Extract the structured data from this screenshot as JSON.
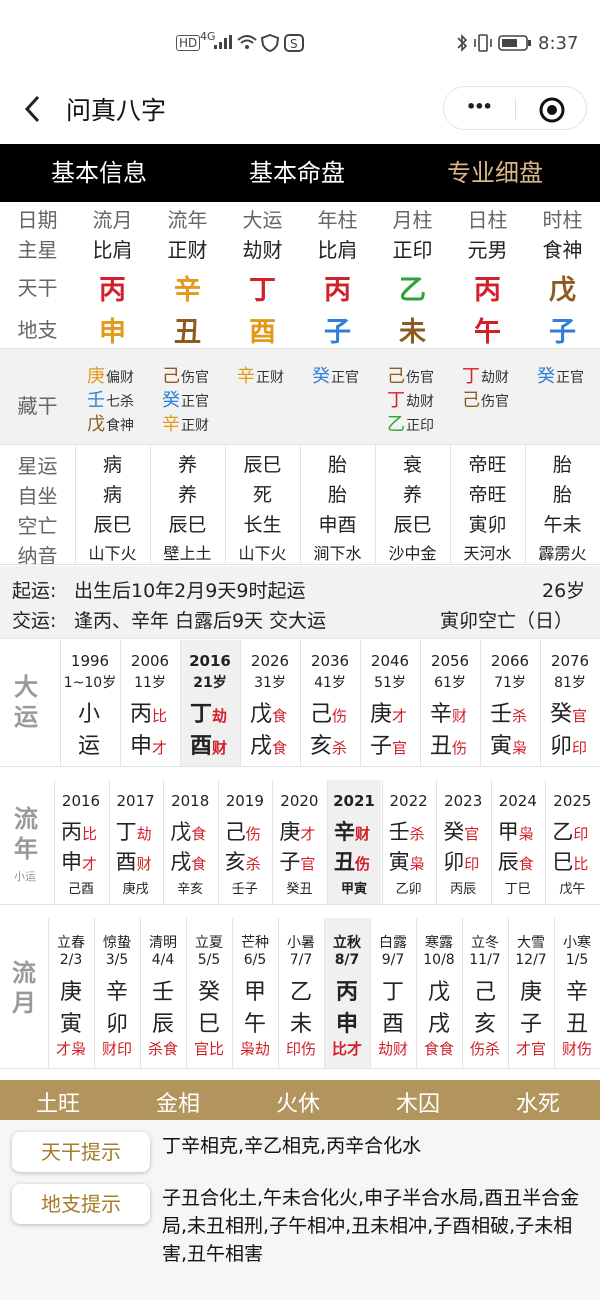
{
  "status": {
    "badge_hd": "HD",
    "net": "4G",
    "time": "8:37"
  },
  "app": {
    "title": "问真八字",
    "back": "〈",
    "more": "•••"
  },
  "tabs": [
    {
      "label": "基本信息"
    },
    {
      "label": "基本命盘"
    },
    {
      "label": "专业细盘"
    }
  ],
  "chart": {
    "row_labels": [
      "日期",
      "主星",
      "天干",
      "地支"
    ],
    "columns": [
      {
        "head": "流月",
        "star": "比肩",
        "stem": "丙",
        "branch": "申"
      },
      {
        "head": "流年",
        "star": "正财",
        "stem": "辛",
        "branch": "丑"
      },
      {
        "head": "大运",
        "star": "劫财",
        "stem": "丁",
        "branch": "酉"
      },
      {
        "head": "年柱",
        "star": "比肩",
        "stem": "丙",
        "branch": "子"
      },
      {
        "head": "月柱",
        "star": "正印",
        "stem": "乙",
        "branch": "未"
      },
      {
        "head": "日柱",
        "star": "元男",
        "stem": "丙",
        "branch": "午"
      },
      {
        "head": "时柱",
        "star": "食神",
        "stem": "戊",
        "branch": "子"
      }
    ],
    "hidden_label": "藏干",
    "hidden": [
      [
        [
          "庚",
          "偏财"
        ],
        [
          "壬",
          "七杀"
        ],
        [
          "戊",
          "食神"
        ]
      ],
      [
        [
          "己",
          "伤官"
        ],
        [
          "癸",
          "正官"
        ],
        [
          "辛",
          "正财"
        ]
      ],
      [
        [
          "辛",
          "正财"
        ]
      ],
      [
        [
          "癸",
          "正官"
        ]
      ],
      [
        [
          "己",
          "伤官"
        ],
        [
          "丁",
          "劫财"
        ],
        [
          "乙",
          "正印"
        ]
      ],
      [
        [
          "丁",
          "劫财"
        ],
        [
          "己",
          "伤官"
        ]
      ],
      [
        [
          "癸",
          "正官"
        ]
      ]
    ],
    "extra_labels": [
      "星运",
      "自坐",
      "空亡",
      "纳音"
    ],
    "extra": [
      [
        "病",
        "病",
        "辰巳",
        "山下火"
      ],
      [
        "养",
        "养",
        "辰巳",
        "壁上土"
      ],
      [
        "辰巳",
        "死",
        "长生",
        "山下火"
      ],
      [
        "胎",
        "胎",
        "申酉",
        "涧下水"
      ],
      [
        "衰",
        "养",
        "辰巳",
        "沙中金"
      ],
      [
        "帝旺",
        "帝旺",
        "寅卯",
        "天河水"
      ],
      [
        "胎",
        "胎",
        "午未",
        "霹雳火"
      ]
    ]
  },
  "info": {
    "qiyun_label": "起运:",
    "qiyun": "出生后10年2月9天9时起运",
    "age": "26岁",
    "jiaoyun_label": "交运:",
    "jiaoyun": "逢丙、辛年 白露后9天 交大运",
    "kongwang": "寅卯空亡（日）"
  },
  "dayun": {
    "label": "大运",
    "items": [
      {
        "year": "1996",
        "age": "1~10岁",
        "g1": "小",
        "g2": "运",
        "t1": "",
        "t2": ""
      },
      {
        "year": "2006",
        "age": "11岁",
        "g1": "丙",
        "g2": "申",
        "t1": "比",
        "t2": "才"
      },
      {
        "year": "2016",
        "age": "21岁",
        "g1": "丁",
        "g2": "酉",
        "t1": "劫",
        "t2": "财"
      },
      {
        "year": "2026",
        "age": "31岁",
        "g1": "戊",
        "g2": "戌",
        "t1": "食",
        "t2": "食"
      },
      {
        "year": "2036",
        "age": "41岁",
        "g1": "己",
        "g2": "亥",
        "t1": "伤",
        "t2": "杀"
      },
      {
        "year": "2046",
        "age": "51岁",
        "g1": "庚",
        "g2": "子",
        "t1": "才",
        "t2": "官"
      },
      {
        "year": "2056",
        "age": "61岁",
        "g1": "辛",
        "g2": "丑",
        "t1": "财",
        "t2": "伤"
      },
      {
        "year": "2066",
        "age": "71岁",
        "g1": "壬",
        "g2": "寅",
        "t1": "杀",
        "t2": "枭"
      },
      {
        "year": "2076",
        "age": "81岁",
        "g1": "癸",
        "g2": "卯",
        "t1": "官",
        "t2": "印"
      }
    ]
  },
  "liunian": {
    "label": "流年",
    "sub": "小运",
    "items": [
      {
        "year": "2016",
        "g1": "丙",
        "g2": "申",
        "t1": "比",
        "t2": "才",
        "xy": "己酉"
      },
      {
        "year": "2017",
        "g1": "丁",
        "g2": "酉",
        "t1": "劫",
        "t2": "财",
        "xy": "庚戌"
      },
      {
        "year": "2018",
        "g1": "戊",
        "g2": "戌",
        "t1": "食",
        "t2": "食",
        "xy": "辛亥"
      },
      {
        "year": "2019",
        "g1": "己",
        "g2": "亥",
        "t1": "伤",
        "t2": "杀",
        "xy": "壬子"
      },
      {
        "year": "2020",
        "g1": "庚",
        "g2": "子",
        "t1": "才",
        "t2": "官",
        "xy": "癸丑"
      },
      {
        "year": "2021",
        "g1": "辛",
        "g2": "丑",
        "t1": "财",
        "t2": "伤",
        "xy": "甲寅"
      },
      {
        "year": "2022",
        "g1": "壬",
        "g2": "寅",
        "t1": "杀",
        "t2": "枭",
        "xy": "乙卯"
      },
      {
        "year": "2023",
        "g1": "癸",
        "g2": "卯",
        "t1": "官",
        "t2": "印",
        "xy": "丙辰"
      },
      {
        "year": "2024",
        "g1": "甲",
        "g2": "辰",
        "t1": "枭",
        "t2": "食",
        "xy": "丁巳"
      },
      {
        "year": "2025",
        "g1": "乙",
        "g2": "巳",
        "t1": "印",
        "t2": "比",
        "xy": "戊午"
      }
    ]
  },
  "liuyue": {
    "label": "流月",
    "items": [
      {
        "term": "立春",
        "date": "2/3",
        "g1": "庚",
        "g2": "寅",
        "tag": "才枭"
      },
      {
        "term": "惊蛰",
        "date": "3/5",
        "g1": "辛",
        "g2": "卯",
        "tag": "财印"
      },
      {
        "term": "清明",
        "date": "4/4",
        "g1": "壬",
        "g2": "辰",
        "tag": "杀食"
      },
      {
        "term": "立夏",
        "date": "5/5",
        "g1": "癸",
        "g2": "巳",
        "tag": "官比"
      },
      {
        "term": "芒种",
        "date": "6/5",
        "g1": "甲",
        "g2": "午",
        "tag": "枭劫"
      },
      {
        "term": "小暑",
        "date": "7/7",
        "g1": "乙",
        "g2": "未",
        "tag": "印伤"
      },
      {
        "term": "立秋",
        "date": "8/7",
        "g1": "丙",
        "g2": "申",
        "tag": "比才"
      },
      {
        "term": "白露",
        "date": "9/7",
        "g1": "丁",
        "g2": "酉",
        "tag": "劫财"
      },
      {
        "term": "寒露",
        "date": "10/8",
        "g1": "戊",
        "g2": "戌",
        "tag": "食食"
      },
      {
        "term": "立冬",
        "date": "11/7",
        "g1": "己",
        "g2": "亥",
        "tag": "伤杀"
      },
      {
        "term": "大雪",
        "date": "12/7",
        "g1": "庚",
        "g2": "子",
        "tag": "才官"
      },
      {
        "term": "小寒",
        "date": "1/5",
        "g1": "辛",
        "g2": "丑",
        "tag": "财伤"
      }
    ]
  },
  "wuxing": [
    "土旺",
    "金相",
    "火休",
    "木囚",
    "水死"
  ],
  "tips": {
    "tg_label": "天干提示",
    "tg": "丁辛相克,辛乙相克,丙辛合化水",
    "dz_label": "地支提示",
    "dz": "子丑合化土,午未合化火,申子半合水局,酉丑半合金局,未丑相刑,子午相冲,丑未相冲,子酉相破,子未相害,丑午相害"
  }
}
